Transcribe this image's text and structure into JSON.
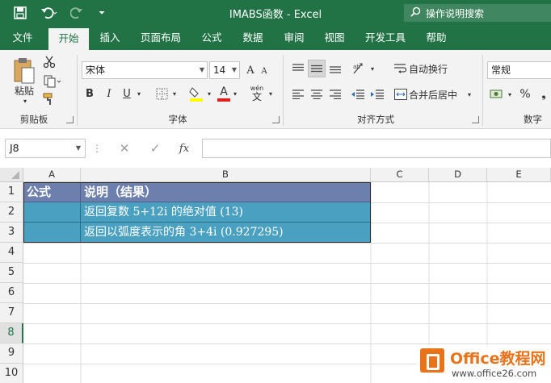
{
  "window": {
    "title": "IMABS函数 - Excel",
    "search_placeholder": "操作说明搜索"
  },
  "tabs": [
    {
      "label": "文件",
      "active": false
    },
    {
      "label": "开始",
      "active": true
    },
    {
      "label": "插入",
      "active": false
    },
    {
      "label": "页面布局",
      "active": false
    },
    {
      "label": "公式",
      "active": false
    },
    {
      "label": "数据",
      "active": false
    },
    {
      "label": "审阅",
      "active": false
    },
    {
      "label": "视图",
      "active": false
    },
    {
      "label": "开发工具",
      "active": false
    },
    {
      "label": "帮助",
      "active": false
    }
  ],
  "ribbon": {
    "clipboard": {
      "paste_label": "粘贴",
      "group_label": "剪贴板"
    },
    "font": {
      "font_name": "宋体",
      "font_size": "14",
      "group_label": "字体",
      "bold": "B",
      "italic": "I",
      "underline": "U",
      "grow": "A",
      "shrink": "A",
      "font_color_letter": "A",
      "wen": "wén"
    },
    "alignment": {
      "wrap_text": "自动换行",
      "merge_center": "合并后居中",
      "group_label": "对齐方式"
    },
    "number": {
      "format": "常规",
      "percent": "%",
      "group_label": "数字"
    }
  },
  "formula_bar": {
    "name_box": "J8",
    "fx": "fx",
    "formula": ""
  },
  "columns": [
    "A",
    "B",
    "C",
    "D",
    "E"
  ],
  "rows": [
    "1",
    "2",
    "3",
    "4",
    "5",
    "6",
    "7",
    "8",
    "9",
    "10"
  ],
  "selected_row": "8",
  "cells": {
    "A1": "公式",
    "B1": "说明（结果）",
    "A2": "",
    "B2": "返回复数 5+12i 的绝对值 (13)",
    "A3": "",
    "B3": "返回以弧度表示的角 3+4i (0.927295)"
  },
  "colors": {
    "excel_green": "#217346",
    "header_fill": "#6d7fac",
    "data_fill": "#4aa0c0"
  },
  "watermark": {
    "name": "Office教程网",
    "url": "www.office26.com"
  }
}
